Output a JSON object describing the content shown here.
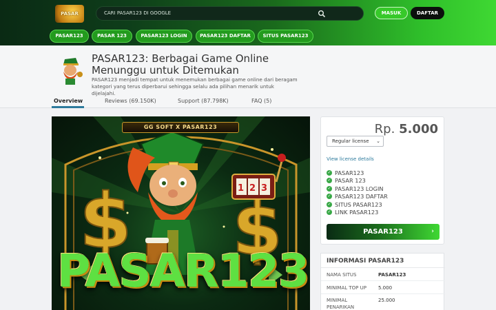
{
  "header": {
    "logo_text": "PASAR",
    "search_placeholder": "CARI PASAR123 DI GOOGLE",
    "search_icon": "search-icon",
    "login_label": "MASUK",
    "register_label": "DAFTAR"
  },
  "nav": [
    "PASAR123",
    "PASAR 123",
    "PASAR123 LOGIN",
    "PASAR123 DAFTAR",
    "SITUS PASAR123"
  ],
  "product": {
    "title": "PASAR123: Berbagai Game Online Menunggu untuk Ditemukan",
    "description": "PASAR123 menjadi tempat untuk menemukan berbagai game online dari beragam kategori yang terus diperbarui sehingga selalu ada pilihan menarik untuk dijelajahi."
  },
  "tabs": [
    "Overview",
    "Reviews (69.150K)",
    "Support (87.798K)",
    "FAQ (5)"
  ],
  "banner": {
    "brand_strip": "GG SOFT X PASAR123",
    "big_text": "PASAR123"
  },
  "buybox": {
    "currency": "Rp.",
    "amount": "5.000",
    "license_selected": "Regular license",
    "details_link": "View license details",
    "features": [
      "PASAR123",
      "PASAR 123",
      "PASAR123 LOGIN",
      "PASAR123 DAFTAR",
      "SITUS PASAR123",
      "LINK PASAR123"
    ],
    "button_label": "PASAR123"
  },
  "info": {
    "title": "INFORMASI PASAR123",
    "rows": [
      {
        "key": "NAMA SITUS",
        "value": "PASAR123"
      },
      {
        "key": "MINIMAL TOP UP",
        "value": "5.000"
      },
      {
        "key": "MINIMAL PENARIKAN",
        "value": "25.000"
      }
    ]
  },
  "colors": {
    "accent_green": "#3fd833",
    "dark_green": "#0a2a14",
    "link_blue": "#2c7a9c"
  }
}
